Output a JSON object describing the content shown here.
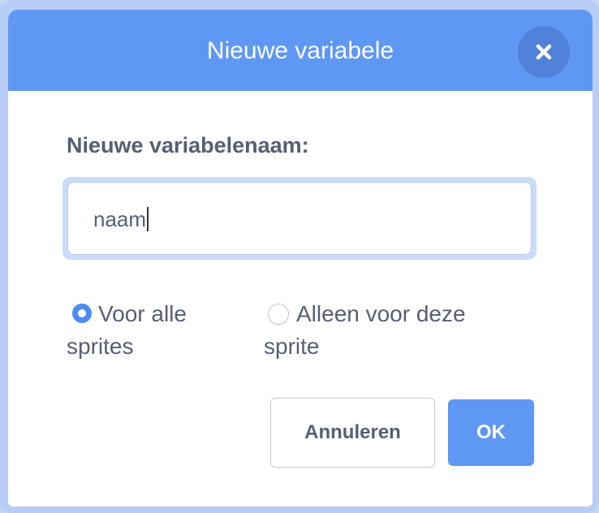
{
  "dialog": {
    "title": "Nieuwe variabele",
    "close_icon": "close-icon",
    "field_label": "Nieuwe variabelenaam:",
    "input_value": "naam",
    "radio_all": {
      "line1": "Voor alle",
      "line2": "sprites",
      "checked": true
    },
    "radio_this": {
      "line1": "Alleen voor deze",
      "line2": "sprite",
      "checked": false
    },
    "cancel_label": "Annuleren",
    "ok_label": "OK"
  },
  "colors": {
    "header": "#5e97f4",
    "close_button": "#4f82d8",
    "text": "#575e75",
    "radio_checked": "#4c8cf5"
  }
}
